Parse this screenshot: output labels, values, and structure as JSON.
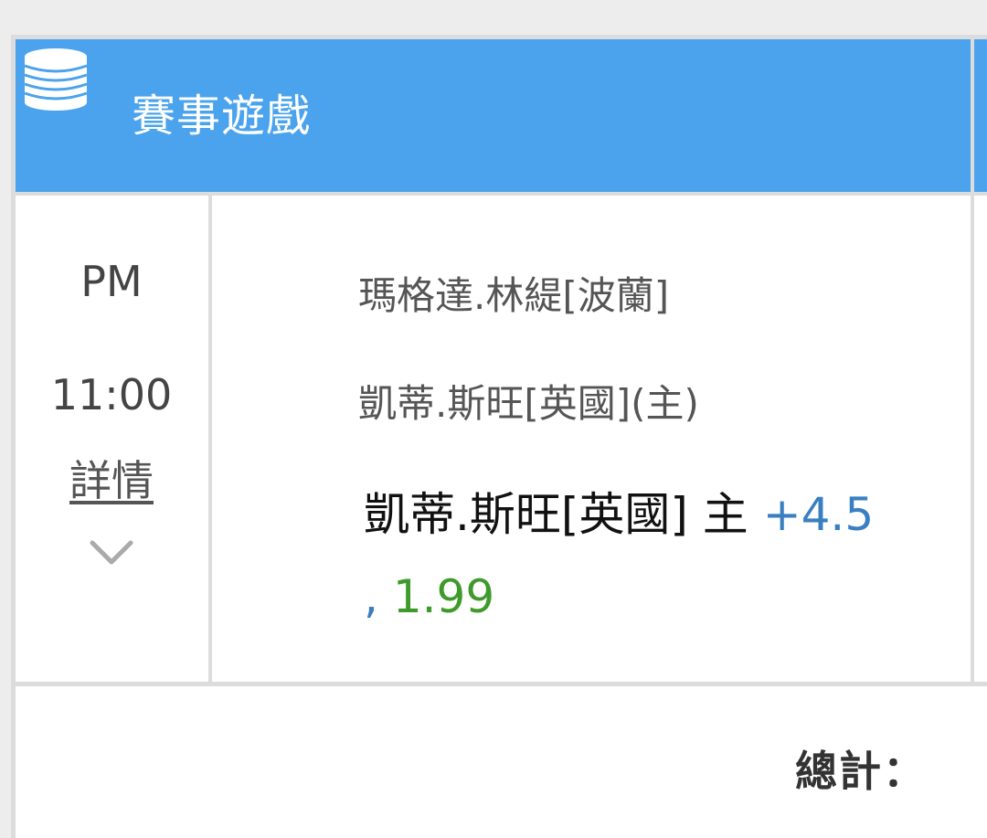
{
  "header": {
    "title": "賽事遊戲",
    "icon": "coin-stack-icon",
    "background_color": "#4aa3ec"
  },
  "match": {
    "time_ampm": "PM",
    "time_clock": "11:00",
    "detail_label": "詳情",
    "team_away": "瑪格達.林緹[波蘭]",
    "team_home": "凱蒂.斯旺[英國](主)",
    "bet": {
      "selection": "凱蒂.斯旺[英國] 主",
      "spread": "+4.5",
      "comma": ",",
      "odds": "1.99"
    }
  },
  "footer": {
    "total_label": "總計："
  },
  "colors": {
    "spread": "#3a7fc1",
    "odds": "#3e9a2a"
  }
}
